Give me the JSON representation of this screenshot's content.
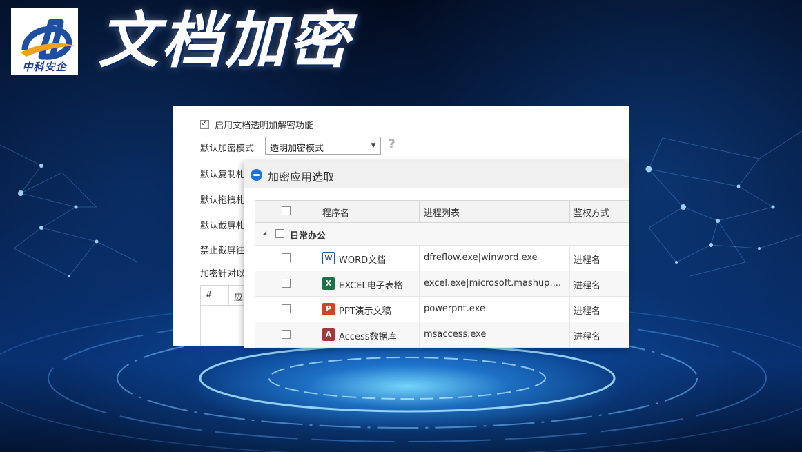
{
  "banner": {
    "title": "文档加密",
    "logo_text": "中科安企"
  },
  "panel": {
    "enable_label": "启用文档透明加解密功能",
    "enable_checked": true,
    "default_mode_label": "默认加密模式",
    "default_mode_value": "透明加密模式",
    "help_glyph": "?",
    "copy_label": "默认复制札",
    "drag_label": "默认拖拽札",
    "screenshot_label": "默认截屏札",
    "forbid_label": "禁止截屏往",
    "target_label": "加密针对以",
    "table_hash": "#",
    "table_col": "应"
  },
  "dialog": {
    "title": "加密应用选取",
    "columns": [
      "程序名",
      "进程列表",
      "鉴权方式"
    ],
    "group": {
      "expander": "◢",
      "name": "日常办公"
    },
    "rows": [
      {
        "name": "WORD文档",
        "processes": "dfreflow.exe|winword.exe",
        "auth": "进程名",
        "icon": "word-icon"
      },
      {
        "name": "EXCEL电子表格",
        "processes": "excel.exe|microsoft.mashup....",
        "auth": "进程名",
        "icon": "excel-icon"
      },
      {
        "name": "PPT演示文稿",
        "processes": "powerpnt.exe",
        "auth": "进程名",
        "icon": "powerpoint-icon"
      },
      {
        "name": "Access数据库",
        "processes": "msaccess.exe",
        "auth": "进程名",
        "icon": "access-icon"
      }
    ]
  },
  "colors": {
    "word": "#2b5797",
    "excel": "#1e7145",
    "powerpoint": "#d04423",
    "access": "#a4373a",
    "accent": "#1e73d8"
  }
}
